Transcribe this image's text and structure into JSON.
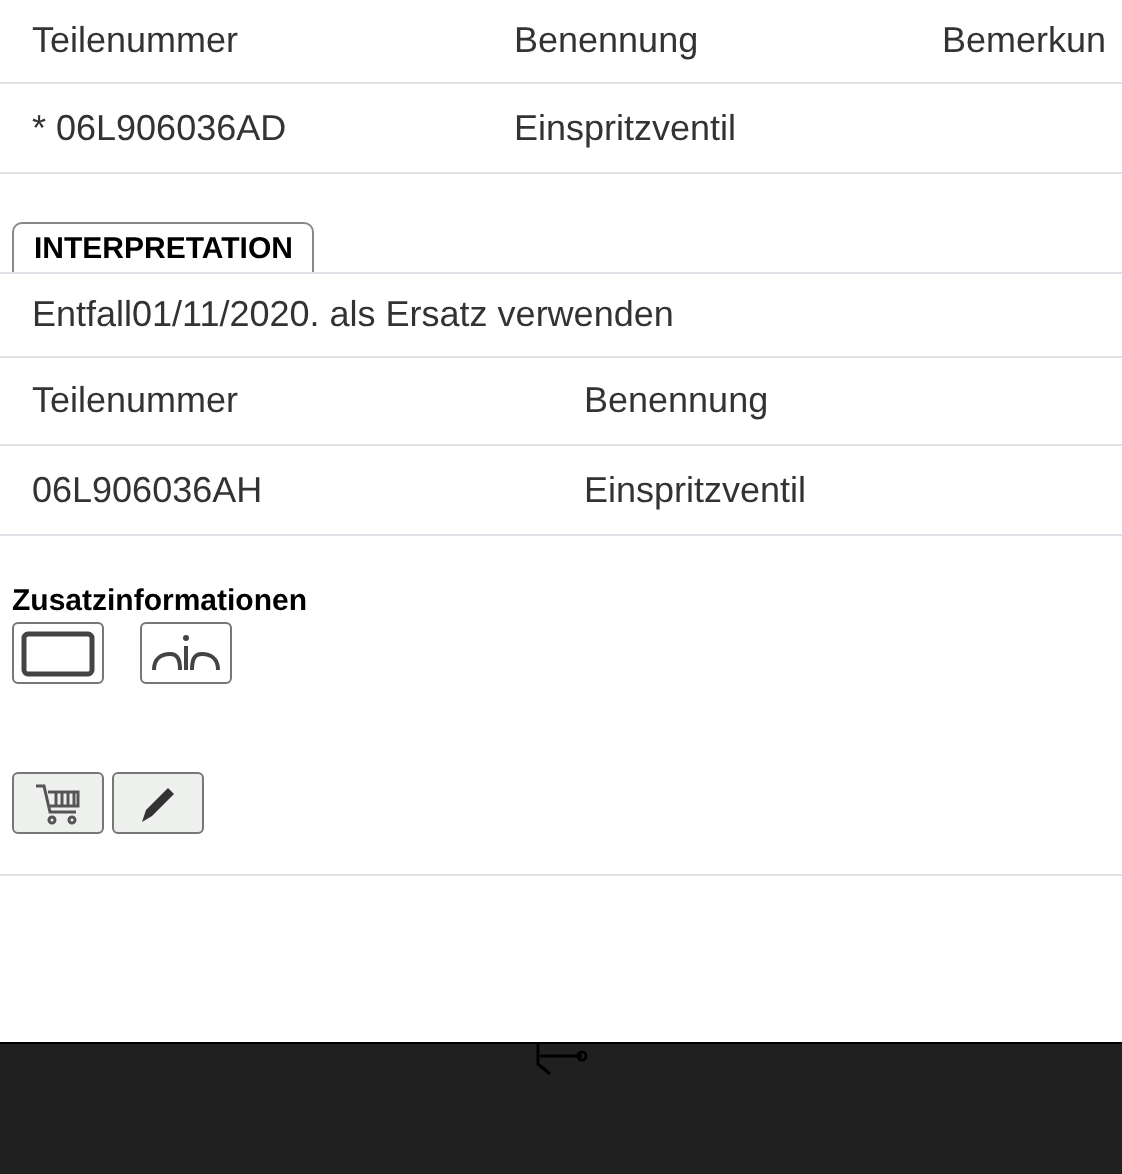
{
  "parts_table": {
    "columns": [
      "Teilenummer",
      "Benennung",
      "Bemerkun"
    ],
    "rows": [
      [
        "* 06L906036AD",
        "Einspritzventil",
        ""
      ]
    ]
  },
  "interpretation": {
    "tab": "INTERPRETATION",
    "note": "Entfall01/11/2020. als Ersatz verwenden",
    "columns": [
      "Teilenummer",
      "Benennung"
    ],
    "rows": [
      [
        "06L906036AH",
        "Einspritzventil"
      ]
    ]
  },
  "additional_info": {
    "title": "Zusatzinformationen"
  }
}
